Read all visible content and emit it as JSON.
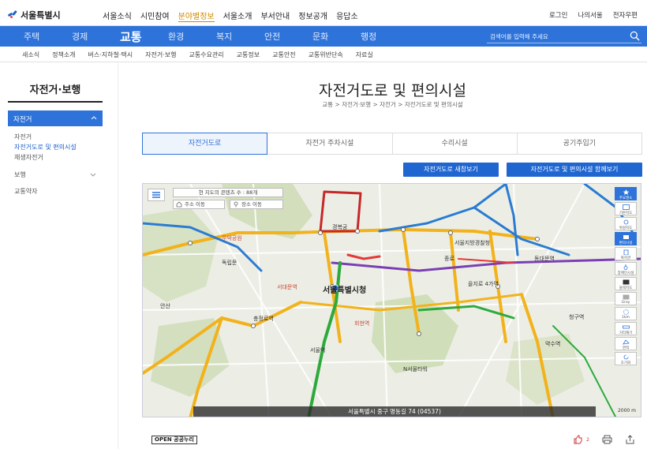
{
  "header": {
    "logo_text": "서울특별시",
    "top_nav": [
      "서울소식",
      "시민참여",
      "분야별정보",
      "서울소개",
      "부서안내",
      "정보공개",
      "응답소"
    ],
    "top_nav_active": "분야별정보",
    "util_links": [
      "로그인",
      "나의서울",
      "전자우편"
    ]
  },
  "main_nav": {
    "items": [
      "주택",
      "경제",
      "교통",
      "환경",
      "복지",
      "안전",
      "문화",
      "행정"
    ],
    "active": "교통",
    "search_placeholder": "검색어를 입력해 주세요"
  },
  "sub_nav": {
    "items": [
      "새소식",
      "정책소개",
      "버스·지하철·택시",
      "자전거·보행",
      "교통수요관리",
      "교통정보",
      "교통안전",
      "교통위반단속",
      "자료실"
    ]
  },
  "sidebar": {
    "title": "자전거·보행",
    "active_section": "자전거",
    "sub_items": [
      "자전거",
      "자전거도로 및 편의시설",
      "재생자전거"
    ],
    "selected_sub": "자전거도로 및 편의시설",
    "items": [
      "보행",
      "교통약자"
    ]
  },
  "content": {
    "title": "자전거도로 및 편의시설",
    "breadcrumb": "교통  >  자전거·보행  >  자전거  >  자전거도로 및 편의시설",
    "tabs": [
      "자전거도로",
      "자전거 주차시설",
      "수리시설",
      "공기주입기"
    ],
    "active_tab": "자전거도로",
    "buttons": [
      "자전거도로 새창보기",
      "자전거도로 및 편의시설 함께보기"
    ]
  },
  "map": {
    "content_count": "현 지도의 콘텐츠 수 : 88개",
    "chips": [
      "주소 이동",
      "장소 이동"
    ],
    "labels": {
      "city_hall": "서울특별시청",
      "gyeongbokgung": "경복궁",
      "jongno": "종로",
      "seoul_station": "서울역",
      "chungjeongno": "충정로역",
      "dongdaemun": "동대문역",
      "euljiro": "을지로 4가역",
      "muak": "무악공원",
      "seodaemun": "서대문역",
      "cheonggu": "청구역",
      "yaksu": "약수역",
      "hoehyeon": "회현역",
      "namsan": "N서울타워",
      "seoul_police": "서울지방경찰청",
      "ansan": "안산",
      "dongnimmun": "독립문"
    },
    "toolbar": [
      "주요명소",
      "기본지도",
      "위성지도",
      "편의시설",
      "복지관",
      "장애인시설",
      "블랙지도",
      "Gray",
      "1km",
      "거리재기",
      "면적",
      "초기화"
    ],
    "address": "서울특별시 중구 명동길 74 (04537)",
    "scale": "2000 m"
  },
  "footer": {
    "open_badge": "OPEN 공공누리",
    "like_count": "2"
  },
  "colors": {
    "brand_blue": "#2e73d9",
    "active_orange": "#d08a00"
  }
}
